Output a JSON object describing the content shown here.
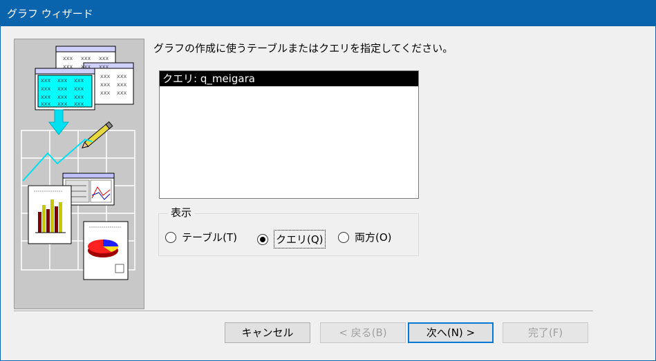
{
  "window": {
    "title": "グラフ ウィザード"
  },
  "instruction": "グラフの作成に使うテーブルまたはクエリを指定してください。",
  "list": {
    "items": [
      "クエリ: q_meigara"
    ],
    "selected_index": 0
  },
  "view_group": {
    "label": "表示",
    "options": [
      {
        "label": "テーブル(T)",
        "checked": false
      },
      {
        "label": "クエリ(Q)",
        "checked": true
      },
      {
        "label": "両方(O)",
        "checked": false
      }
    ]
  },
  "buttons": {
    "cancel": "キャンセル",
    "back": "< 戻る(B)",
    "next": "次へ(N) >",
    "finish": "完了(F)"
  },
  "illustration": {
    "cell_text": "xxx"
  }
}
